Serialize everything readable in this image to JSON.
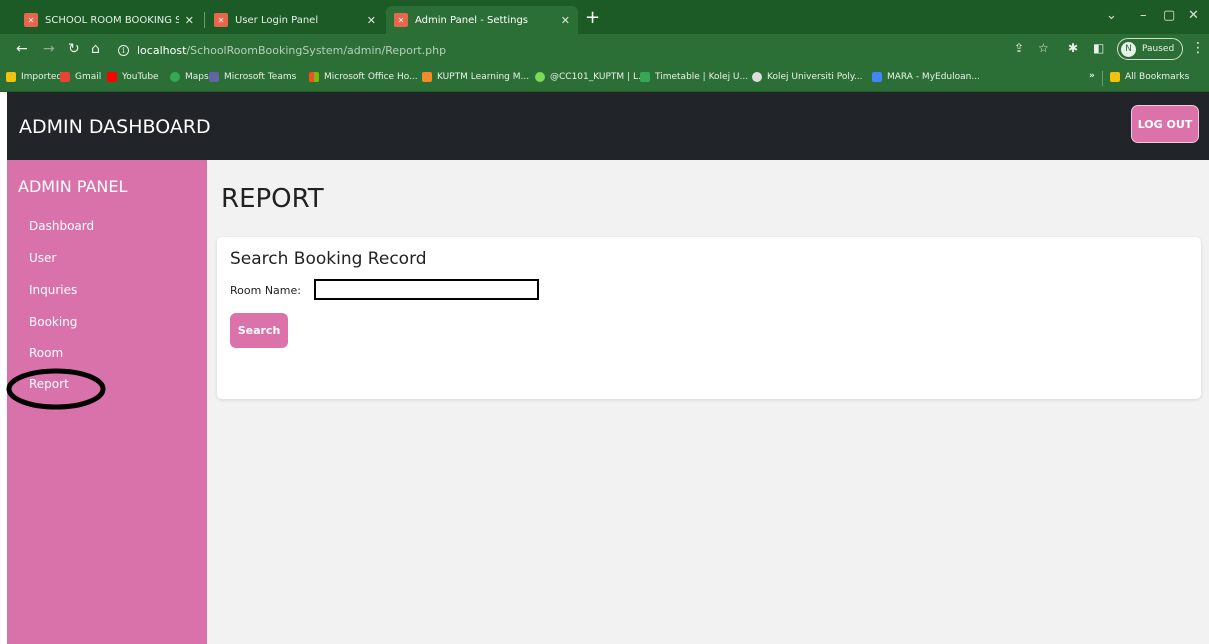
{
  "browser": {
    "tabs": [
      {
        "title": "SCHOOL ROOM BOOKING SYST",
        "active": false
      },
      {
        "title": "User Login Panel",
        "active": false
      },
      {
        "title": "Admin Panel - Settings",
        "active": true
      }
    ],
    "url_host": "localhost",
    "url_path": "/SchoolRoomBookingSystem/admin/Report.php",
    "profile_initial": "N",
    "profile_status": "Paused",
    "bookmarks": [
      {
        "label": "Imported",
        "icon": "folder-icon",
        "color": "#f4c20d"
      },
      {
        "label": "Gmail",
        "icon": "gmail-icon",
        "color": "#ea4335"
      },
      {
        "label": "YouTube",
        "icon": "youtube-icon",
        "color": "#ff0000"
      },
      {
        "label": "Maps",
        "icon": "maps-icon",
        "color": "#34a853"
      },
      {
        "label": "Microsoft Teams",
        "icon": "teams-icon",
        "color": "#6264a7"
      },
      {
        "label": "Microsoft Office Ho...",
        "icon": "office-icon",
        "color": "#f25022"
      },
      {
        "label": "KUPTM Learning M...",
        "icon": "kuptm-icon",
        "color": "#f28c28"
      },
      {
        "label": "@CC101_KUPTM | L...",
        "icon": "spark-icon",
        "color": "#7ed957"
      },
      {
        "label": "Timetable | Kolej U...",
        "icon": "timetable-icon",
        "color": "#34a853"
      },
      {
        "label": "Kolej Universiti Poly...",
        "icon": "globe-icon",
        "color": "#dddddd"
      },
      {
        "label": "MARA - MyEduloan...",
        "icon": "mara-icon",
        "color": "#4285f4"
      }
    ],
    "more_bookmarks": "»",
    "all_bookmarks": "All Bookmarks"
  },
  "header": {
    "title": "ADMIN DASHBOARD",
    "logout_label": "LOG OUT"
  },
  "sidebar": {
    "title": "ADMIN PANEL",
    "items": [
      "Dashboard",
      "User",
      "Inquries",
      "Booking",
      "Room",
      "Report"
    ]
  },
  "main": {
    "page_title": "REPORT",
    "card_title": "Search Booking Record",
    "field_label": "Room Name:",
    "room_input_value": "",
    "search_label": "Search"
  },
  "colors": {
    "accent": "#db72a9",
    "sidebar": "#d972ab",
    "header": "#212529",
    "browser_frame": "#2c6f36"
  }
}
